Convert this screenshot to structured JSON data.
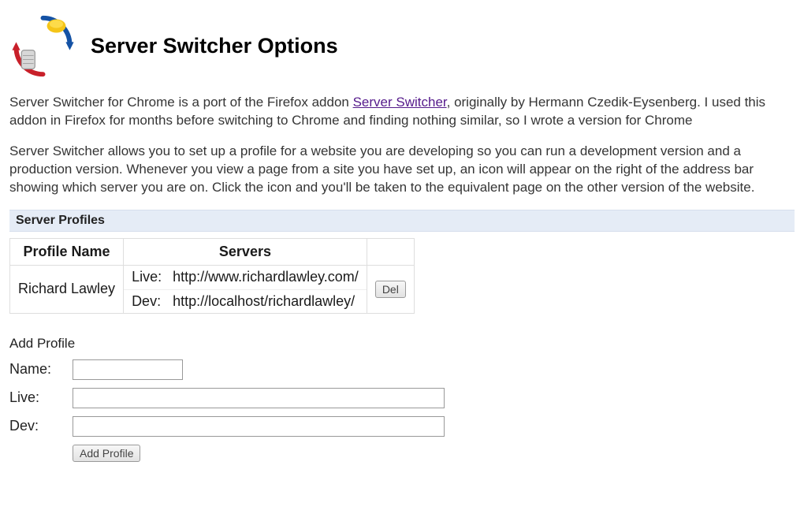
{
  "header": {
    "title": "Server Switcher Options"
  },
  "intro": {
    "p1_before": "Server Switcher for Chrome is a port of the Firefox addon ",
    "p1_link": "Server Switcher",
    "p1_after": ", originally by Hermann Czedik-Eysenberg. I used this addon in Firefox for months before switching to Chrome and finding nothing similar, so I wrote a version for Chrome",
    "p2": "Server Switcher allows you to set up a profile for a website you are developing so you can run a development version and a production version. Whenever you view a page from a site you have set up, an icon will appear on the right of the address bar showing which server you are on. Click the icon and you'll be taken to the equivalent page on the other version of the website."
  },
  "profiles": {
    "section_title": "Server Profiles",
    "columns": {
      "name": "Profile Name",
      "servers": "Servers"
    },
    "rows": [
      {
        "name": "Richard Lawley",
        "live_label": "Live:",
        "live_url": "http://www.richardlawley.com/",
        "dev_label": "Dev:",
        "dev_url": "http://localhost/richardlawley/",
        "del_label": "Del"
      }
    ]
  },
  "add_form": {
    "heading": "Add Profile",
    "name_label": "Name:",
    "live_label": "Live:",
    "dev_label": "Dev:",
    "submit_label": "Add Profile",
    "name_value": "",
    "live_value": "",
    "dev_value": ""
  }
}
